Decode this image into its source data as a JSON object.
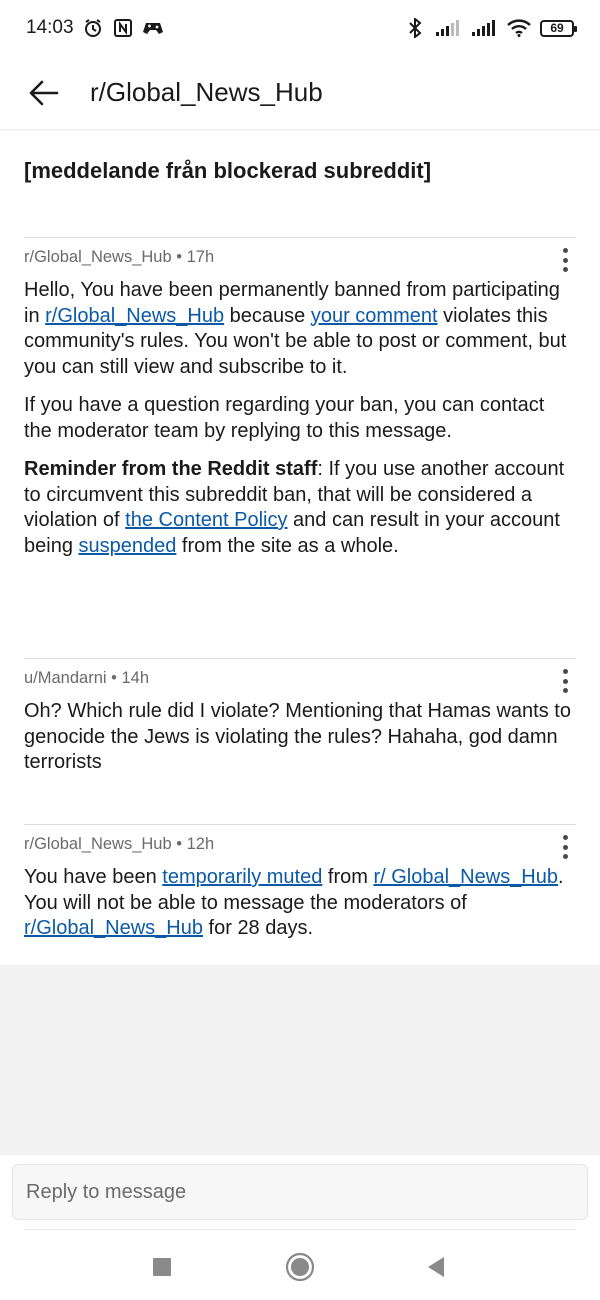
{
  "status_bar": {
    "time": "14:03",
    "battery": "69",
    "left_icons": [
      "alarm-icon",
      "nfc-icon",
      "game-controller-icon"
    ],
    "right_icons": [
      "bluetooth-icon",
      "signal-icon",
      "signal-icon",
      "wifi-icon",
      "battery-icon"
    ]
  },
  "header": {
    "title": "r/Global_News_Hub",
    "back_icon": "arrow-left-icon"
  },
  "subject": "[meddelande från blockerad subreddit]",
  "messages": [
    {
      "meta": "r/Global_News_Hub • 17h",
      "p1": {
        "t1": "Hello, You have been permanently banned from participating in ",
        "link1": "r/Global_News_Hub",
        "t2": " because ",
        "link2": "your comment",
        "t3": " violates this community's rules. You won't be able to post or comment, but you can still view and subscribe to it."
      },
      "p2": "If you have a question regarding your ban, you can contact the moderator team by replying to this message.",
      "p3": {
        "bold": "Reminder from the Reddit staff",
        "t1": ": If you use another account to circumvent this subreddit ban, that will be considered a violation of ",
        "link1": "the Content Policy",
        "t2": " and can result in your account being ",
        "link2": "suspended",
        "t3": " from the site as a whole."
      }
    },
    {
      "meta": "u/Mandarni • 14h",
      "text": "Oh? Which rule did I violate? Mentioning that Hamas wants to genocide the Jews is violating the rules? Hahaha, god damn terrorists"
    },
    {
      "meta": "r/Global_News_Hub • 12h",
      "t1": "You have been ",
      "link1": "temporarily muted",
      "t2": " from ",
      "link2": "r/ Global_News_Hub",
      "t3": ". You will not be able to message the moderators of ",
      "link3": "r/Global_News_Hub",
      "t4": " for 28 days."
    }
  ],
  "reply": {
    "placeholder": "Reply to message"
  },
  "nav": [
    "square-icon",
    "home-circle-icon",
    "back-triangle-icon"
  ],
  "colors": {
    "link": "#0b5aa8",
    "text": "#1a1a1b",
    "meta": "#6a6a6a",
    "background_gray": "#f1f1f2"
  }
}
